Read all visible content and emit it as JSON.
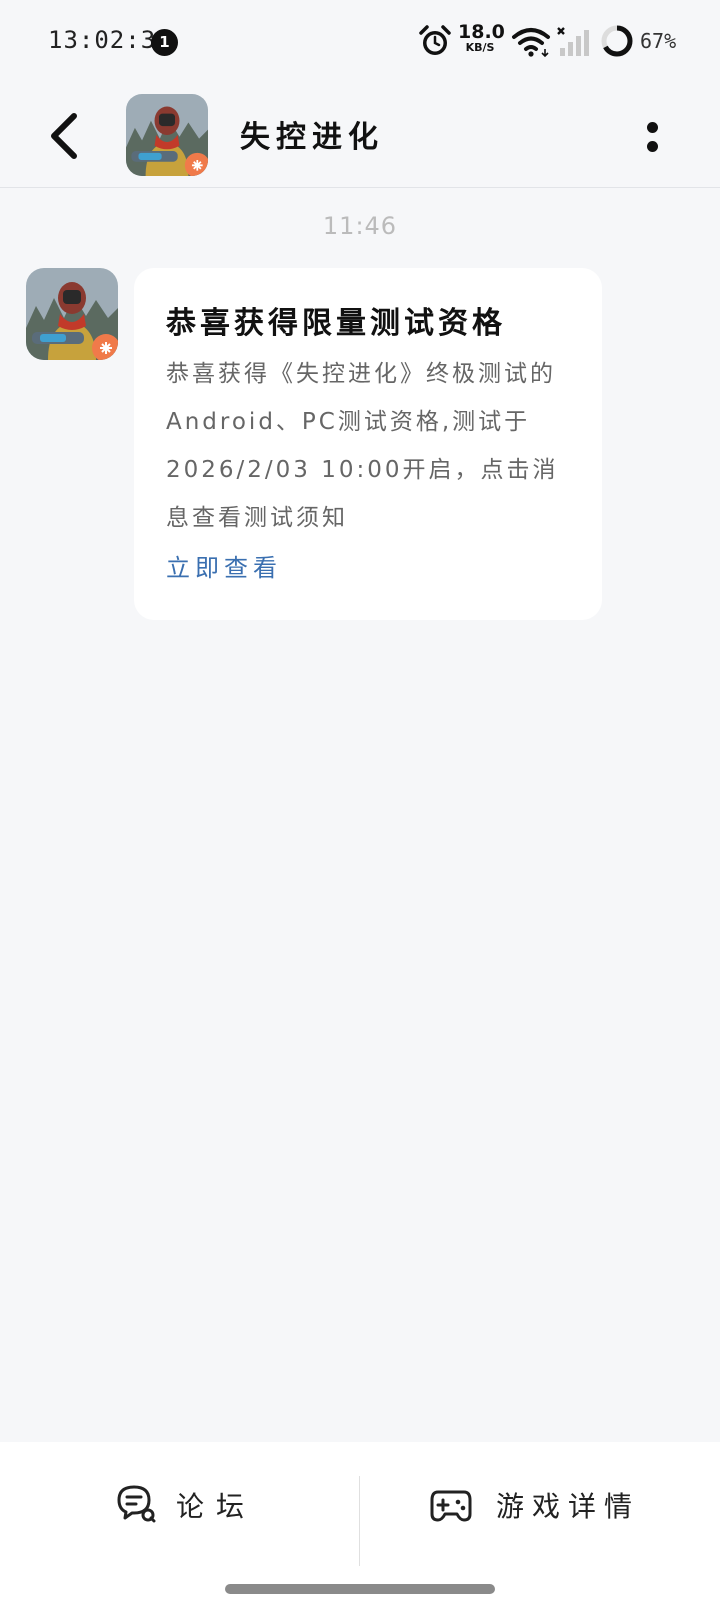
{
  "status_bar": {
    "time": "13:02:38",
    "notification_count": "1",
    "network_speed_value": "18.0",
    "network_speed_unit": "KB/S",
    "battery_percent": "67%",
    "icons": [
      "alarm-icon",
      "wifi-icon",
      "signal-icon",
      "battery-ring-icon"
    ]
  },
  "header": {
    "title": "失控进化",
    "back_icon": "chevron-left-icon",
    "more_icon": "more-vertical-icon"
  },
  "conversation": {
    "timestamp": "11:46",
    "message": {
      "title": "恭喜获得限量测试资格",
      "body": "恭喜获得《失控进化》终极测试的Android、PC测试资格,测试于2026/2/03 10:00开启，点击消息查看测试须知",
      "link_label": "立即查看"
    }
  },
  "bottom_nav": {
    "forum_label": "论坛",
    "forum_icon": "forum-chat-icon",
    "game_details_label": "游戏详情",
    "game_details_icon": "gamepad-icon"
  },
  "colors": {
    "background": "#f6f7f9",
    "bubble": "#ffffff",
    "link": "#3a6fb0",
    "body_text": "#666666"
  }
}
